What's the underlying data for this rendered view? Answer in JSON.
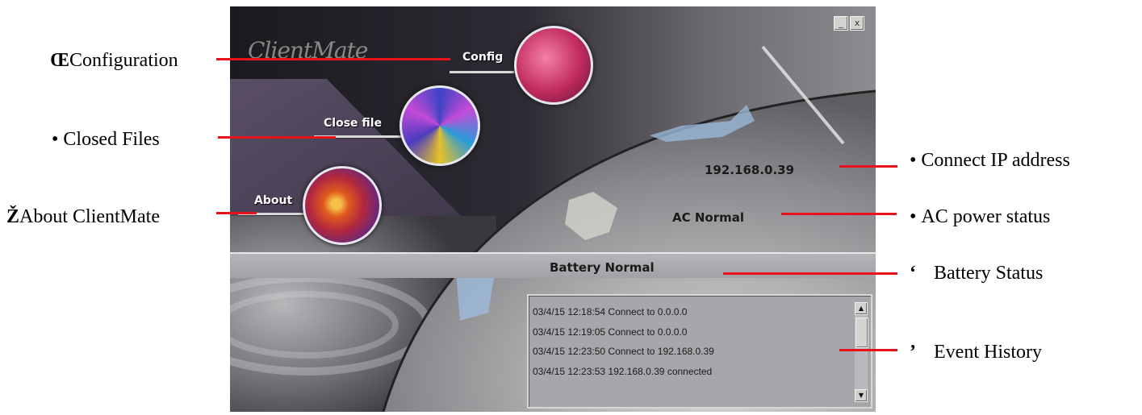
{
  "window": {
    "logo": "ClientMate",
    "controls": [
      "_",
      "x"
    ]
  },
  "menu": {
    "config": "Config",
    "close_file": "Close file",
    "about": "About"
  },
  "status": {
    "ip": "192.168.0.39",
    "ac": "AC Normal",
    "battery": "Battery Normal"
  },
  "events": [
    "03/4/15 12:18:54 Connect to 0.0.0.0",
    "03/4/15 12:19:05 Connect to 0.0.0.0",
    "03/4/15 12:23:50 Connect to 192.168.0.39",
    "03/4/15 12:23:53 192.168.0.39 connected"
  ],
  "scrollbar": {
    "up": "▲",
    "down": "▼"
  },
  "annotations": {
    "configuration": {
      "marker": "Œ",
      "label": "Configuration"
    },
    "closed_files": {
      "marker": "•",
      "label": "Closed Files"
    },
    "about": {
      "marker": "Ž",
      "label": "About ClientMate"
    },
    "ip": {
      "marker": "•",
      "label": "Connect IP address"
    },
    "ac": {
      "marker": "•",
      "label": "AC power status"
    },
    "battery": {
      "marker": "‘",
      "label": "Battery Status"
    },
    "events": {
      "marker": "’",
      "label": "Event History"
    }
  },
  "colors": {
    "annotation_line": "#e5141b"
  }
}
